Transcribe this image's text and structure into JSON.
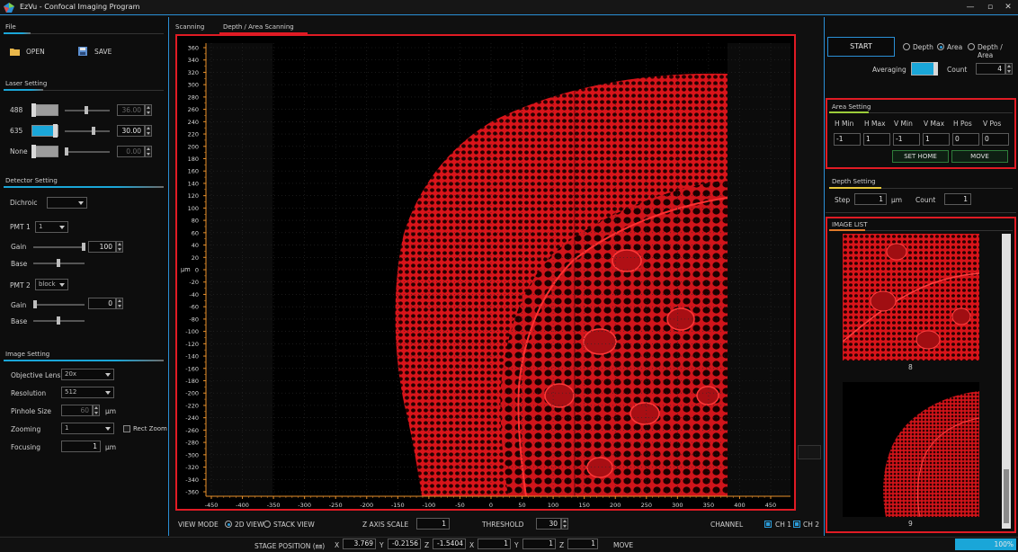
{
  "window": {
    "title": "EzVu - Confocal Imaging Program"
  },
  "file": {
    "section": "File",
    "open": "OPEN",
    "save": "SAVE"
  },
  "laser": {
    "section": "Laser Setting",
    "rows": [
      {
        "label": "488",
        "value": "36.00",
        "color": "#9c9c9c",
        "enabled": false,
        "level": 0.48
      },
      {
        "label": "635",
        "value": "30.00",
        "color": "#1aa6d8",
        "enabled": true,
        "level": 0.66
      },
      {
        "label": "None",
        "value": "0.00",
        "color": "#9c9c9c",
        "enabled": false,
        "level": 0.0
      }
    ]
  },
  "detector": {
    "section": "Detector Setting",
    "dichroic_label": "Dichroic",
    "dichroic_value": "",
    "pmt1_label": "PMT 1",
    "pmt1_value": "1",
    "gain_label": "Gain",
    "gain1_value": "100",
    "base_label": "Base",
    "pmt2_label": "PMT 2",
    "pmt2_value": "block",
    "gain2_value": "0"
  },
  "image": {
    "section": "Image Setting",
    "objective_label": "Objective Lens",
    "objective_value": "20x",
    "resolution_label": "Resolution",
    "resolution_value": "512",
    "pinhole_label": "Pinhole Size",
    "pinhole_value": "60",
    "pinhole_unit": "μm",
    "zoom_label": "Zooming",
    "zoom_value": "1",
    "rect_zoom": "Rect Zoom",
    "focus_label": "Focusing",
    "focus_value": "1",
    "focus_unit": "μm"
  },
  "tabs": [
    "Scanning",
    "Depth / Area Scanning"
  ],
  "plot": {
    "y_unit": "μm",
    "y_ticks": [
      "360",
      "340",
      "320",
      "300",
      "280",
      "260",
      "240",
      "220",
      "200",
      "180",
      "160",
      "140",
      "120",
      "100",
      "80",
      "60",
      "40",
      "20",
      "0",
      "-20",
      "-40",
      "-60",
      "-80",
      "-100",
      "-120",
      "-140",
      "-160",
      "-180",
      "-200",
      "-220",
      "-240",
      "-260",
      "-280",
      "-300",
      "-320",
      "-340",
      "-360"
    ],
    "x_ticks": [
      "-450",
      "-400",
      "-350",
      "-300",
      "-250",
      "-200",
      "-150",
      "-100",
      "-50",
      "0",
      "50",
      "100",
      "150",
      "200",
      "250",
      "300",
      "350",
      "400",
      "450"
    ]
  },
  "view": {
    "mode_label": "VIEW MODE",
    "opt_2d": "2D VIEW",
    "opt_stack": "STACK VIEW",
    "zaxis_label": "Z AXIS SCALE",
    "zaxis_value": "1",
    "threshold_label": "THRESHOLD",
    "threshold_value": "30",
    "channel_label": "CHANNEL",
    "ch1": "CH 1",
    "ch2": "CH 2"
  },
  "control": {
    "start": "START",
    "mode_depth": "Depth",
    "mode_area": "Area",
    "mode_both": "Depth / Area",
    "averaging_label": "Averaging",
    "count_label": "Count",
    "count_value": "4"
  },
  "area": {
    "section": "Area Setting",
    "headers": [
      "H Min",
      "H Max",
      "V Min",
      "V Max",
      "H Pos",
      "V Pos"
    ],
    "values": [
      "-1",
      "1",
      "-1",
      "1",
      "0",
      "0"
    ],
    "set_home": "SET HOME",
    "move": "MOVE"
  },
  "depth": {
    "section": "Depth Setting",
    "step_label": "Step",
    "step_value": "1",
    "step_unit": "μm",
    "count_label": "Count",
    "count_value": "1"
  },
  "image_list": {
    "section": "IMAGE LIST",
    "items": [
      {
        "caption": "8"
      },
      {
        "caption": "9"
      }
    ]
  },
  "status": {
    "stage_label": "STAGE POSITION (㎜)",
    "x_label": "X",
    "x_value": "3.769",
    "y_label": "Y",
    "y_value": "-0.2156",
    "z_label": "Z",
    "z_value": "-1.5404",
    "x2_label": "X",
    "x2_value": "1",
    "y2_label": "Y",
    "y2_value": "1",
    "z2_label": "Z",
    "z2_value": "1",
    "move": "MOVE",
    "progress": "100%",
    "progress_fraction": 1.0
  },
  "colors": {
    "accent": "#1aa6d8",
    "highlight_frame": "#e01b24",
    "specimen": "#e8171b"
  }
}
